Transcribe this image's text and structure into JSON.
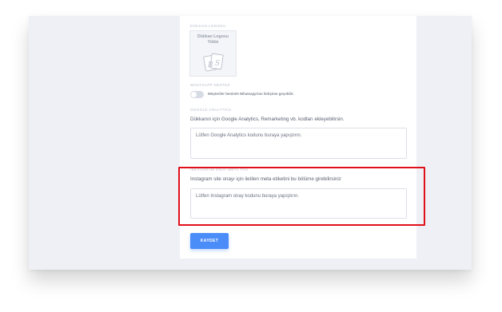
{
  "store_logo": {
    "section_label": "DÜKKAN LOGOSU",
    "upload_line1": "Dükkan Logosu",
    "upload_line2": "Yükle",
    "icon": "image-upload-icon"
  },
  "whatsapp": {
    "section_label": "WHATSAPP DESTEK",
    "toggle_text": "Müşteriler benimle Whatsapp'tan iletişime geçebilir.",
    "toggle_on": false
  },
  "google_analytics": {
    "section_label": "GOOGLE ANALYTICS",
    "description": "Dükkanın için Google Analytics, Remarketing vb. kodları ekleyebilirsin.",
    "placeholder": "Lütfen Google Analytics kodunu buraya yapıştırın."
  },
  "instagram": {
    "section_label": "INSTAGRAM ONAY META TAG",
    "description": "Instagram site onayı için iletilen meta etiketini bu bölüme girebilirsiniz",
    "placeholder": "Lütfen Instagram onay kodunu buraya yapıştırın."
  },
  "actions": {
    "save_label": "KAYDET"
  },
  "colors": {
    "accent": "#4b8df8",
    "highlight": "#e0101a",
    "background": "#eef0f5"
  }
}
